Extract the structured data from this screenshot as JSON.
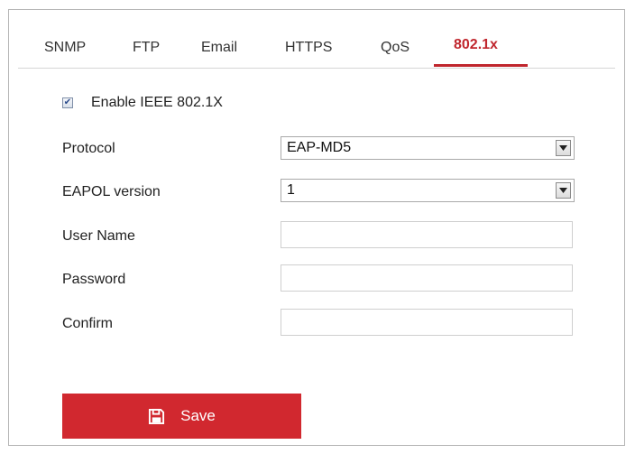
{
  "tabs": [
    {
      "label": "SNMP",
      "active": false
    },
    {
      "label": "FTP",
      "active": false
    },
    {
      "label": "Email",
      "active": false
    },
    {
      "label": "HTTPS",
      "active": false
    },
    {
      "label": "QoS",
      "active": false
    },
    {
      "label": "802.1x",
      "active": true
    }
  ],
  "form": {
    "enable": {
      "label": "Enable IEEE 802.1X",
      "checked": true
    },
    "protocol": {
      "label": "Protocol",
      "value": "EAP-MD5"
    },
    "eapol_version": {
      "label": "EAPOL version",
      "value": "1"
    },
    "user_name": {
      "label": "User Name",
      "value": ""
    },
    "password": {
      "label": "Password",
      "value": ""
    },
    "confirm": {
      "label": "Confirm",
      "value": ""
    }
  },
  "save_button": {
    "label": "Save",
    "icon": "floppy-disk-icon"
  },
  "colors": {
    "accent": "#d1282f",
    "active_tab": "#c0262d"
  }
}
